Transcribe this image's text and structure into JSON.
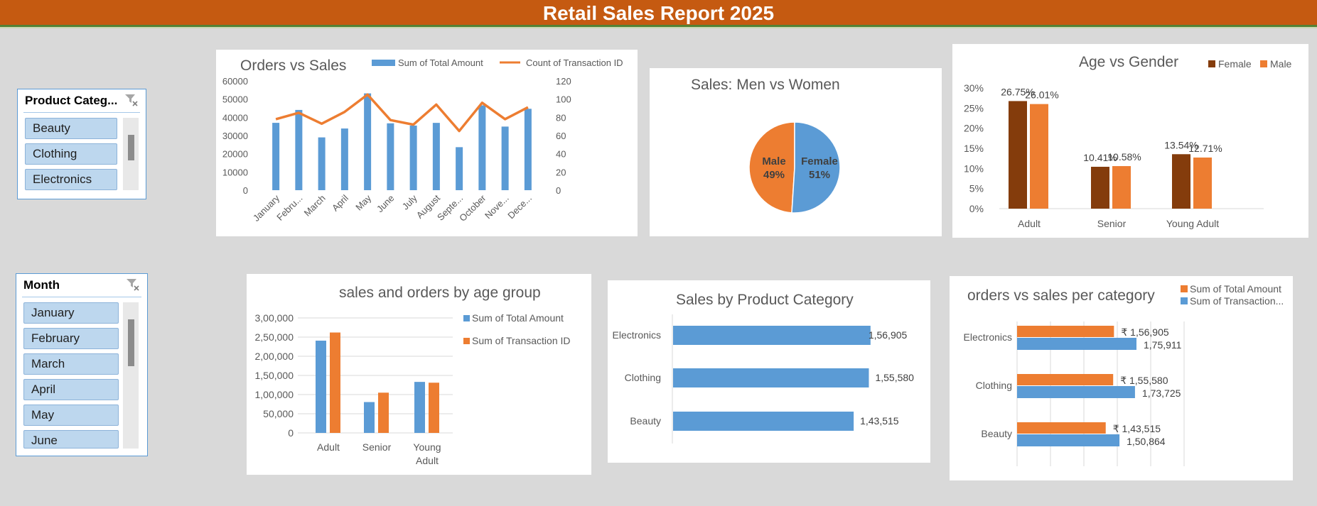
{
  "header": {
    "title": "Retail Sales Report 2025"
  },
  "slicers": {
    "category": {
      "title": "Product Categ...",
      "items": [
        "Beauty",
        "Clothing",
        "Electronics"
      ]
    },
    "month": {
      "title": "Month",
      "items": [
        "January",
        "February",
        "March",
        "April",
        "May",
        "June"
      ]
    }
  },
  "icons": {
    "slicer_clear": "filter-clear-icon"
  },
  "colors": {
    "banner": "#c55a11",
    "blue": "#5b9bd5",
    "orange": "#ed7d31",
    "brown": "#843c0c",
    "slicer_item": "#bdd7ee"
  },
  "chart_data": [
    {
      "id": "orders_vs_sales",
      "type": "bar",
      "title": "Orders vs Sales",
      "categories": [
        "January",
        "Febru...",
        "March",
        "April",
        "May",
        "June",
        "July",
        "August",
        "Septe...",
        "October",
        "Nove...",
        "Dece..."
      ],
      "series": [
        {
          "name": "Sum of Total Amount",
          "kind": "bar",
          "axis": "left",
          "values": [
            36980,
            44060,
            28990,
            33870,
            53150,
            36715,
            35465,
            36960,
            23620,
            46580,
            34920,
            44690
          ]
        },
        {
          "name": "Count of Transaction ID",
          "kind": "line",
          "axis": "right",
          "values": [
            78,
            85,
            73,
            86,
            105,
            77,
            72,
            94,
            65,
            96,
            78,
            91
          ]
        }
      ],
      "left_ticks": [
        "60000",
        "50000",
        "40000",
        "30000",
        "20000",
        "10000",
        "0"
      ],
      "right_ticks": [
        "120",
        "100",
        "80",
        "60",
        "40",
        "20",
        "0"
      ],
      "ylim": [
        0,
        60000
      ],
      "y2lim": [
        0,
        120
      ],
      "legend": "top"
    },
    {
      "id": "men_vs_women",
      "type": "pie",
      "title": "Sales: Men vs Women",
      "slices": [
        {
          "name": "Male",
          "label": "49%",
          "value": 49
        },
        {
          "name": "Female",
          "label": "51%",
          "value": 51
        }
      ]
    },
    {
      "id": "age_vs_gender",
      "type": "bar",
      "title": "Age vs Gender",
      "categories": [
        "Adult",
        "Senior",
        "Young Adult"
      ],
      "series": [
        {
          "name": "Female",
          "values": [
            26.75,
            10.41,
            13.54
          ],
          "labels": [
            "26.75%",
            "10.41%",
            "13.54%"
          ]
        },
        {
          "name": "Male",
          "values": [
            26.01,
            10.58,
            12.71
          ],
          "labels": [
            "26.01%",
            "10.58%",
            "12.71%"
          ]
        }
      ],
      "ticks": [
        "30%",
        "25%",
        "20%",
        "15%",
        "10%",
        "5%",
        "0%"
      ],
      "ylim": [
        0,
        30
      ],
      "legend": "top-right"
    },
    {
      "id": "sales_orders_age_group",
      "type": "bar",
      "title": "sales and orders by age group",
      "categories": [
        "Adult",
        "Senior",
        "Young Adult"
      ],
      "series": [
        {
          "name": "Sum of Total Amount",
          "values": [
            240700,
            80500,
            133100
          ]
        },
        {
          "name": "Sum of Transaction ID",
          "values": [
            262000,
            105000,
            131000
          ]
        }
      ],
      "ticks": [
        "3,00,000",
        "2,50,000",
        "2,00,000",
        "1,50,000",
        "1,00,000",
        "50,000",
        "0"
      ],
      "ylim": [
        0,
        300000
      ],
      "legend": "right"
    },
    {
      "id": "sales_by_category",
      "type": "bar",
      "orientation": "horizontal",
      "title": "Sales by Product Category",
      "categories": [
        "Electronics",
        "Clothing",
        "Beauty"
      ],
      "values": [
        156905,
        155580,
        143515
      ],
      "labels": [
        "1,56,905",
        "1,55,580",
        "1,43,515"
      ]
    },
    {
      "id": "orders_vs_sales_category",
      "type": "bar",
      "orientation": "horizontal",
      "title": "orders vs sales per category",
      "categories": [
        "Electronics",
        "Clothing",
        "Beauty"
      ],
      "series": [
        {
          "name": "Sum of Total Amount",
          "values": [
            156905,
            155580,
            143515
          ],
          "labels": [
            "₹ 1,56,905",
            "₹ 1,55,580",
            "₹ 1,43,515"
          ]
        },
        {
          "name": "Sum of Transaction...",
          "values": [
            175911,
            173725,
            150864
          ],
          "labels": [
            "1,75,911",
            "1,73,725",
            "1,50,864"
          ]
        }
      ],
      "legend": "top-right"
    }
  ]
}
